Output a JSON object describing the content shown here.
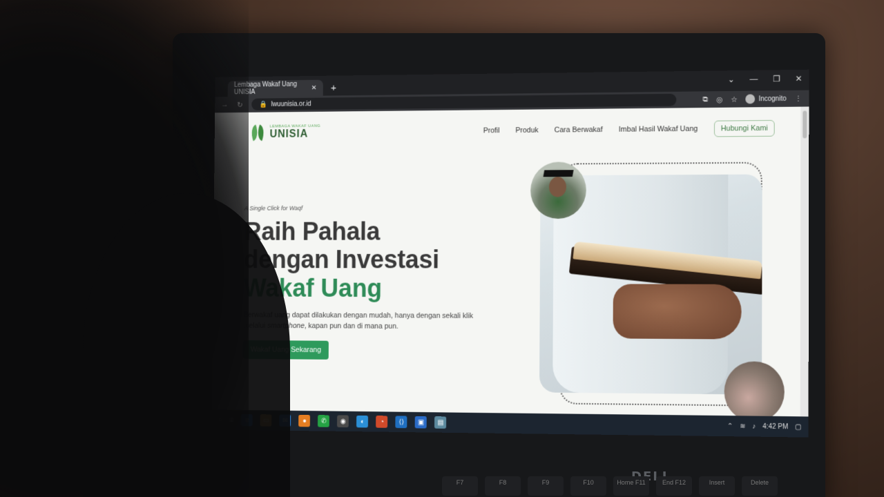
{
  "browser": {
    "tab_title": "Lembaga Wakaf Uang UNISIA",
    "new_tab": "+",
    "url": "lwuunisia.or.id",
    "incognito_label": "Incognito"
  },
  "site": {
    "logo_small": "LEMBAGA WAKAF UANG",
    "logo_big": "UNISIA",
    "nav": [
      "Profil",
      "Produk",
      "Cara Berwakaf",
      "Imbal Hasil Wakaf Uang"
    ],
    "cta": "Hubungi Kami"
  },
  "hero": {
    "tagline": "A Single Click for Waqf",
    "title_line1": "Raih Pahala",
    "title_line2": "dengan Investasi",
    "title_line3": "Wakaf Uang",
    "description_part1": "Berwakaf uang dapat dilakukan dengan mudah, hanya dengan sekali klik melalui ",
    "description_em": "smartphone",
    "description_part2": ", kapan pun dan di mana pun.",
    "button": "Wakaf Uang Sekarang"
  },
  "taskbar": {
    "time": "4:42 PM"
  },
  "laptop": {
    "brand": "DELL",
    "keys": [
      "F7",
      "F8",
      "F9",
      "F10",
      "Home F11",
      "End F12",
      "Insert",
      "Delete"
    ]
  },
  "colors": {
    "accent_green": "#2e8b57",
    "button_green": "#2e9a5c",
    "dark_text": "#3a3a3a"
  }
}
